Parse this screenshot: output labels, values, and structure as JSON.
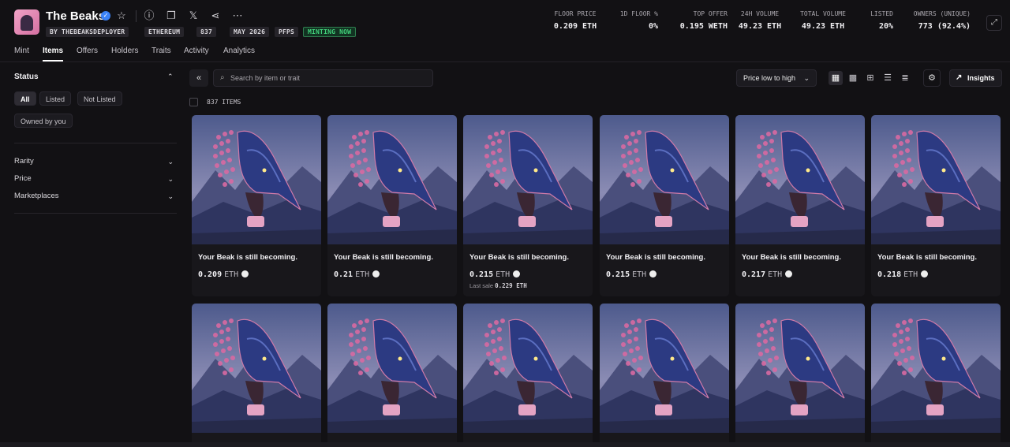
{
  "collection": {
    "title": "The Beaks",
    "pills": [
      "BY THEBEAKSDEPLOYER",
      "ETHEREUM",
      "837",
      "MAY 2026",
      "PFPS",
      "MINTING NOW"
    ]
  },
  "stats": [
    {
      "label": "FLOOR PRICE",
      "value": "0.209 ETH"
    },
    {
      "label": "1D FLOOR %",
      "value": "0%"
    },
    {
      "label": "TOP OFFER",
      "value": "0.195 WETH"
    },
    {
      "label": "24H VOLUME",
      "value": "49.23 ETH"
    },
    {
      "label": "TOTAL VOLUME",
      "value": "49.23 ETH"
    },
    {
      "label": "LISTED",
      "value": "20%"
    },
    {
      "label": "OWNERS (UNIQUE)",
      "value": "773 (92.4%)"
    }
  ],
  "nav": [
    "Mint",
    "Items",
    "Offers",
    "Holders",
    "Traits",
    "Activity",
    "Analytics"
  ],
  "sidebar": {
    "status_title": "Status",
    "chips": [
      "All",
      "Listed",
      "Not Listed",
      "Owned by you"
    ],
    "filters": [
      "Rarity",
      "Price",
      "Marketplaces"
    ]
  },
  "toolbar": {
    "search_placeholder": "Search by item or trait",
    "sort_label": "Price low to high",
    "insights_label": "Insights",
    "item_count": "837 ITEMS"
  },
  "cards": [
    {
      "name": "Your Beak is still becoming.",
      "price": "0.209",
      "currency": "ETH",
      "last_sale": ""
    },
    {
      "name": "Your Beak is still becoming.",
      "price": "0.21",
      "currency": "ETH",
      "last_sale": ""
    },
    {
      "name": "Your Beak is still becoming.",
      "price": "0.215",
      "currency": "ETH",
      "last_sale_label": "Last sale",
      "last_sale": "0.229 ETH"
    },
    {
      "name": "Your Beak is still becoming.",
      "price": "0.215",
      "currency": "ETH",
      "last_sale": ""
    },
    {
      "name": "Your Beak is still becoming.",
      "price": "0.217",
      "currency": "ETH",
      "last_sale": ""
    },
    {
      "name": "Your Beak is still becoming.",
      "price": "0.218",
      "currency": "ETH",
      "last_sale": ""
    }
  ],
  "colors": {
    "background": "#121114",
    "minting_green": "#41d07a",
    "verified_blue": "#3b82f6"
  }
}
